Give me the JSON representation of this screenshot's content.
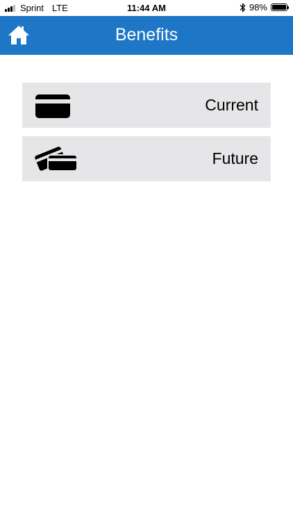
{
  "status_bar": {
    "carrier": "Sprint",
    "network": "LTE",
    "time": "11:44 AM",
    "battery_percent": "98%",
    "battery_level": 0.98,
    "signal_bars": 3,
    "icons": [
      "signal-icon",
      "bluetooth-icon",
      "battery-icon"
    ]
  },
  "header": {
    "title": "Benefits",
    "home_icon": "home-icon",
    "background_color": "#1e76c6"
  },
  "menu": {
    "items": [
      {
        "label": "Current",
        "icon": "credit-card-icon"
      },
      {
        "label": "Future",
        "icon": "stacked-cards-icon"
      }
    ],
    "row_color": "#e6e6e8"
  }
}
